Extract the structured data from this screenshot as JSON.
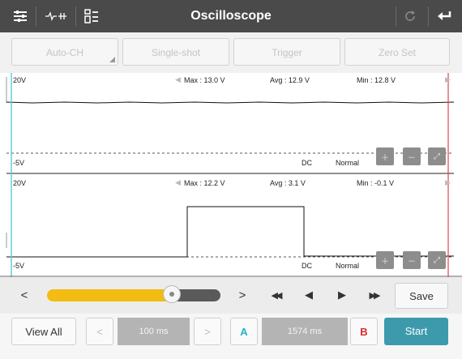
{
  "topbar": {
    "title": "Oscilloscope",
    "icons": [
      "sliders-icon",
      "waveform-adjust-icon",
      "layout-list-icon",
      "refresh-icon",
      "back-arrow-icon"
    ]
  },
  "modes": {
    "auto_ch": "Auto-CH",
    "single_shot": "Single-shot",
    "trigger": "Trigger",
    "zero_set": "Zero Set"
  },
  "channels": [
    {
      "scale_top": "20V",
      "scale_bottom": "-5V",
      "max": "Max : 13.0 V",
      "avg": "Avg : 12.9 V",
      "min": "Min : 12.8 V",
      "coupling": "DC",
      "mode": "Normal"
    },
    {
      "scale_top": "20V",
      "scale_bottom": "-5V",
      "max": "Max : 12.2 V",
      "avg": "Avg : 3.1 V",
      "min": "Min : -0.1 V",
      "coupling": "DC",
      "mode": "Normal"
    }
  ],
  "navigation": {
    "prev": "<",
    "next": ">",
    "rewind": "◀◀",
    "step_back": "◀",
    "step_forward": "▶",
    "fast_forward": "▶▶",
    "save": "Save",
    "slider_position": 0.72
  },
  "bottom": {
    "view_all": "View All",
    "prev": "<",
    "timebase": "100 ms",
    "next": ">",
    "cursor_a": "A",
    "cursor_delta": "1574 ms",
    "cursor_b": "B",
    "start": "Start"
  },
  "colors": {
    "topbar": "#4a4a4a",
    "accent": "#3d9aad",
    "slider_fill": "#f3bc12",
    "cursor_a": "#22b1c9",
    "cursor_b": "#d92b2b",
    "cursor_a_line": "#5ed0d6",
    "cursor_b_line": "#e04848"
  }
}
